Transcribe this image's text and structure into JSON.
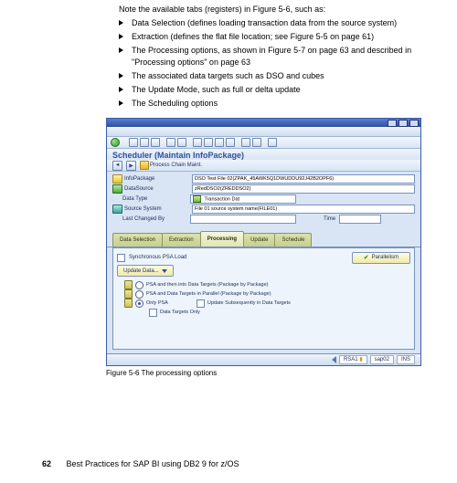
{
  "intro": "Note the available tabs (registers) in Figure 5-6, such as:",
  "bullets": [
    "Data Selection (defines loading transaction data from the source system)",
    "Extraction (defines the flat file location; see Figure 5-5 on page 61)",
    "The Processing options, as shown in Figure 5-7 on page 63 and described in \"Processing options\" on page 63",
    "The associated data targets such as DSO and cubes",
    "The Update Mode, such as full or delta update",
    "The Scheduling options"
  ],
  "sap": {
    "heading": "Scheduler (Maintain InfoPackage)",
    "subtoolbar": {
      "process_chain": "Process Chain Maint."
    },
    "fields": {
      "infopackage_label": "InfoPackage",
      "infopackage_value": "DSO Test File 02(ZPAK_45AWK5Q1DWUDDU92J42B2OPF6)",
      "datasource_label": "DataSource",
      "datasource_value": "zRedDSO2(ZREDDSO2)",
      "datatype_label": "Data Type",
      "datatype_value": "Transaction Dat",
      "sourcesys_label": "Source System",
      "sourcesys_value": "File 01 source system name(FILE01)",
      "lastchanged_label": "Last Changed By",
      "lastchanged_value": "",
      "time_label": "Time"
    },
    "tabs": {
      "data_selection": "Data Selection",
      "extraction": "Extraction",
      "processing": "Processing",
      "update": "Update",
      "schedule": "Schedule"
    },
    "panel": {
      "sync_psa": "Synchronous PSA Load",
      "parallelism": "Parallelism",
      "update_data": "Update Data...",
      "opt1": "PSA and then into Data Targets (Package by Package)",
      "opt2": "PSA and Data Targets in Parallel (Package by Package)",
      "opt3": "Only PSA",
      "opt3_sub_a": "Update Subsequently in Data Targets",
      "opt3_sub_b": "Data Targets Only"
    },
    "status": {
      "cell1": "RSA1",
      "cell2": "sap02",
      "cell3": "INS"
    }
  },
  "caption": "Figure 5-6   The processing options",
  "footer": {
    "page": "62",
    "title": "Best Practices for SAP BI using DB2 9 for z/OS"
  }
}
